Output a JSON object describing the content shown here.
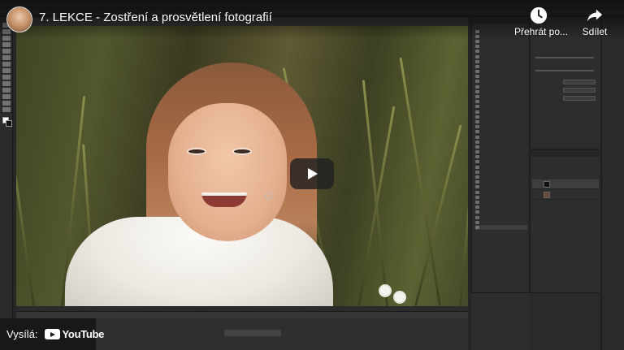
{
  "video": {
    "title": "7. LEKCE - Zostření a prosvětlení fotografií",
    "channel_avatar_icon": "channel-avatar"
  },
  "actions": {
    "watch_later_label": "Přehrát po...",
    "share_label": "Sdílet"
  },
  "player": {
    "play_icon": "play-icon"
  },
  "badge": {
    "via_label": "Vysílá:",
    "youtube_logo_text": "YouTube"
  },
  "colors": {
    "overlay_text": "#ffffff",
    "play_button_bg": "#212121",
    "photoshop_panel": "#2d2d2d"
  }
}
